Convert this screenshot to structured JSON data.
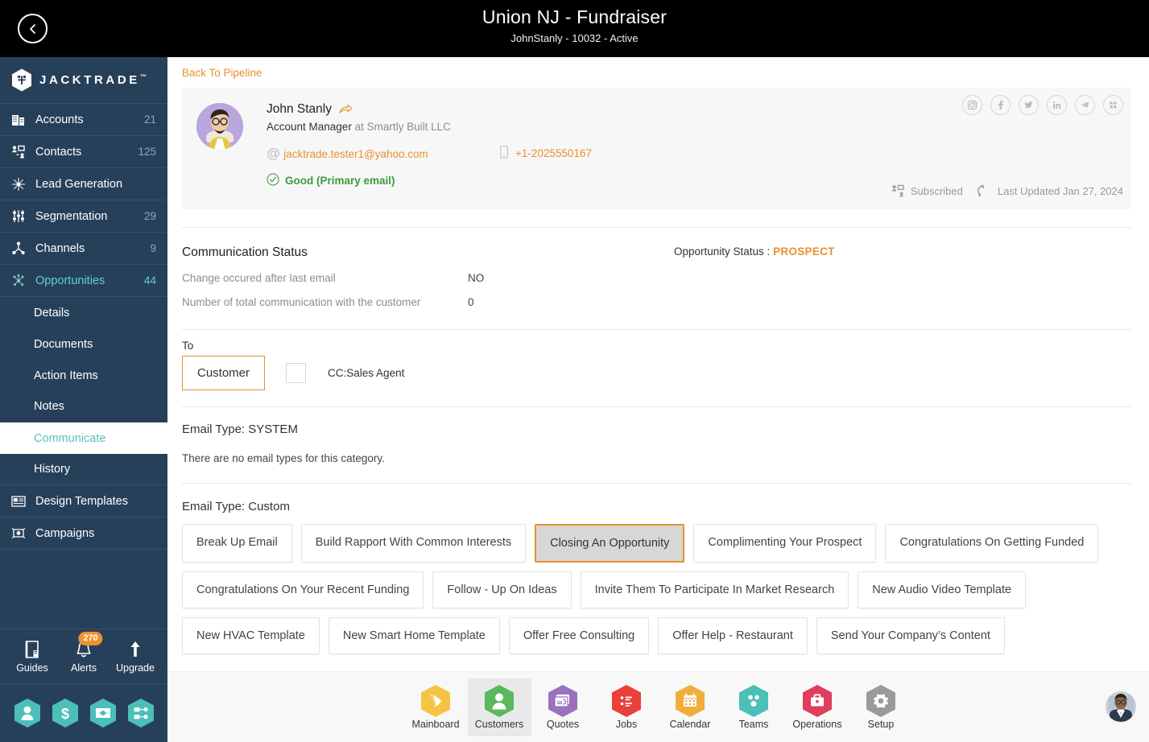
{
  "topbar": {
    "back_icon": "chevron-left-icon",
    "title": "Union NJ - Fundraiser",
    "subtitle": "JohnStanly - 10032 - Active"
  },
  "sidebar": {
    "brand": "JACKTRADE",
    "brand_tm": "™",
    "items": [
      {
        "label": "Accounts",
        "count": "21",
        "icon": "building-icon",
        "active": false
      },
      {
        "label": "Contacts",
        "count": "125",
        "icon": "contacts-icon",
        "active": false
      },
      {
        "label": "Lead Generation",
        "count": "",
        "icon": "lead-generation-icon",
        "active": false
      },
      {
        "label": "Segmentation",
        "count": "29",
        "icon": "segmentation-icon",
        "active": false
      },
      {
        "label": "Channels",
        "count": "9",
        "icon": "channels-icon",
        "active": false
      },
      {
        "label": "Opportunities",
        "count": "44",
        "icon": "opportunities-icon",
        "active": true
      }
    ],
    "sub_items": [
      {
        "label": "Details",
        "selected": false
      },
      {
        "label": "Documents",
        "selected": false
      },
      {
        "label": "Action Items",
        "selected": false
      },
      {
        "label": "Notes",
        "selected": false
      },
      {
        "label": "Communicate",
        "selected": true
      },
      {
        "label": "History",
        "selected": false
      }
    ],
    "items_after": [
      {
        "label": "Design Templates",
        "count": "",
        "icon": "design-templates-icon",
        "active": false
      },
      {
        "label": "Campaigns",
        "count": "",
        "icon": "campaigns-icon",
        "active": false
      }
    ],
    "utils": [
      {
        "label": "Guides",
        "icon": "book-icon",
        "badge": ""
      },
      {
        "label": "Alerts",
        "icon": "bell-icon",
        "badge": "270"
      },
      {
        "label": "Upgrade",
        "icon": "up-arrow-icon",
        "badge": ""
      }
    ],
    "quick_hexes": [
      {
        "icon": "person-hex-icon"
      },
      {
        "icon": "dollar-hex-icon"
      },
      {
        "icon": "payment-hex-icon"
      },
      {
        "icon": "workflow-hex-icon"
      }
    ]
  },
  "main": {
    "back_link": "Back To Pipeline",
    "profile": {
      "name": "John Stanly",
      "share_icon": "share-arrow-icon",
      "role": "Account Manager",
      "role_suffix": "at Smartly Built LLC",
      "email": "jacktrade.tester1@yahoo.com",
      "phone": "+1-2025550167",
      "email_status": "Good (Primary email)",
      "subscribed": "Subscribed",
      "last_updated": "Last Updated Jan 27, 2024",
      "socials": [
        {
          "icon": "instagram-icon"
        },
        {
          "icon": "facebook-icon"
        },
        {
          "icon": "twitter-icon"
        },
        {
          "icon": "linkedin-icon"
        },
        {
          "icon": "telegram-icon"
        },
        {
          "icon": "apps-grid-icon"
        }
      ]
    },
    "communication": {
      "heading": "Communication Status",
      "rows": [
        {
          "key": "Change occured after last email",
          "value": "NO"
        },
        {
          "key": "Number of total communication with the customer",
          "value": "0"
        }
      ],
      "opportunity_status_label": "Opportunity Status :",
      "opportunity_status_value": "PROSPECT"
    },
    "to_section": {
      "label": "To",
      "customer_tab": "Customer",
      "cc_checkbox_checked": false,
      "cc_label": "CC:Sales Agent"
    },
    "email_type_system": {
      "heading": "Email Type: SYSTEM",
      "note": "There are no email types for this category."
    },
    "email_type_custom": {
      "heading": "Email Type: Custom",
      "templates": [
        {
          "label": "Break Up Email",
          "selected": false
        },
        {
          "label": "Build Rapport With Common Interests",
          "selected": false
        },
        {
          "label": "Closing An Opportunity",
          "selected": true
        },
        {
          "label": "Complimenting Your Prospect",
          "selected": false
        },
        {
          "label": "Congratulations On Getting Funded",
          "selected": false
        },
        {
          "label": "Congratulations On Your Recent Funding",
          "selected": false
        },
        {
          "label": "Follow - Up On Ideas",
          "selected": false
        },
        {
          "label": "Invite Them To Participate In Market Research",
          "selected": false
        },
        {
          "label": "New Audio Video Template",
          "selected": false
        },
        {
          "label": "New HVAC Template",
          "selected": false
        },
        {
          "label": "New Smart Home Template",
          "selected": false
        },
        {
          "label": "Offer Free Consulting",
          "selected": false
        },
        {
          "label": "Offer Help - Restaurant",
          "selected": false
        },
        {
          "label": "Send Your Company’s Content",
          "selected": false
        }
      ]
    }
  },
  "bottom_nav": {
    "items": [
      {
        "label": "Mainboard",
        "icon": "mainboard-icon",
        "color": "#f6c445",
        "active": false
      },
      {
        "label": "Customers",
        "icon": "customers-icon",
        "color": "#5cb85c",
        "active": true
      },
      {
        "label": "Quotes",
        "icon": "quotes-icon",
        "color": "#9b72bd",
        "active": false
      },
      {
        "label": "Jobs",
        "icon": "jobs-icon",
        "color": "#e8403a",
        "active": false
      },
      {
        "label": "Calendar",
        "icon": "calendar-icon",
        "color": "#f0ad3c",
        "active": false
      },
      {
        "label": "Teams",
        "icon": "teams-icon",
        "color": "#4bbfb8",
        "active": false
      },
      {
        "label": "Operations",
        "icon": "operations-icon",
        "color": "#e03e5c",
        "active": false
      },
      {
        "label": "Setup",
        "icon": "setup-gear-icon",
        "color": "#9a9a9a",
        "active": false
      }
    ],
    "user_avatar": "user-avatar"
  },
  "colors": {
    "accent_orange": "#e8912d",
    "sidebar_bg": "#27405a",
    "teal": "#57c3bd",
    "green": "#3d9a3d",
    "topbar_bg": "#000000"
  }
}
